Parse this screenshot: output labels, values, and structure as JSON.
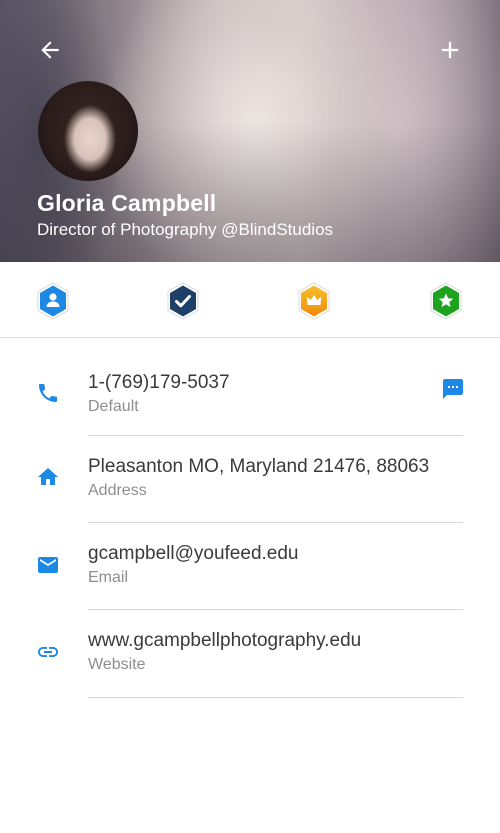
{
  "header": {
    "name": "Gloria Campbell",
    "subtitle": "Director of Photography @BlindStudios",
    "back_icon": "arrow-left-icon",
    "add_icon": "plus-icon",
    "text_color": "#ffffff"
  },
  "badges": [
    {
      "name": "profile-badge",
      "icon": "person-icon",
      "color": "#1e88e5"
    },
    {
      "name": "verified-badge",
      "icon": "check-icon",
      "color": "#1d3f68"
    },
    {
      "name": "premium-badge",
      "icon": "crown-icon",
      "color": "#f39c12"
    },
    {
      "name": "star-badge",
      "icon": "star-icon",
      "color": "#1ea31e"
    }
  ],
  "contacts": {
    "phone": {
      "value": "1-(769)179-5037",
      "label": "Default",
      "icon": "phone-icon",
      "action_icon": "message-icon"
    },
    "address": {
      "value": "Pleasanton MO, Maryland 21476, 88063",
      "label": "Address",
      "icon": "home-icon"
    },
    "email": {
      "value": "gcampbell@youfeed.edu",
      "label": "Email",
      "icon": "email-icon"
    },
    "website": {
      "value": "www.gcampbellphotography.edu",
      "label": "Website",
      "icon": "link-icon"
    }
  },
  "colors": {
    "accent": "#1e88e5",
    "divider": "#d6d6d6",
    "primary_text": "#3a3a3a",
    "secondary_text": "#8e8e8e"
  }
}
